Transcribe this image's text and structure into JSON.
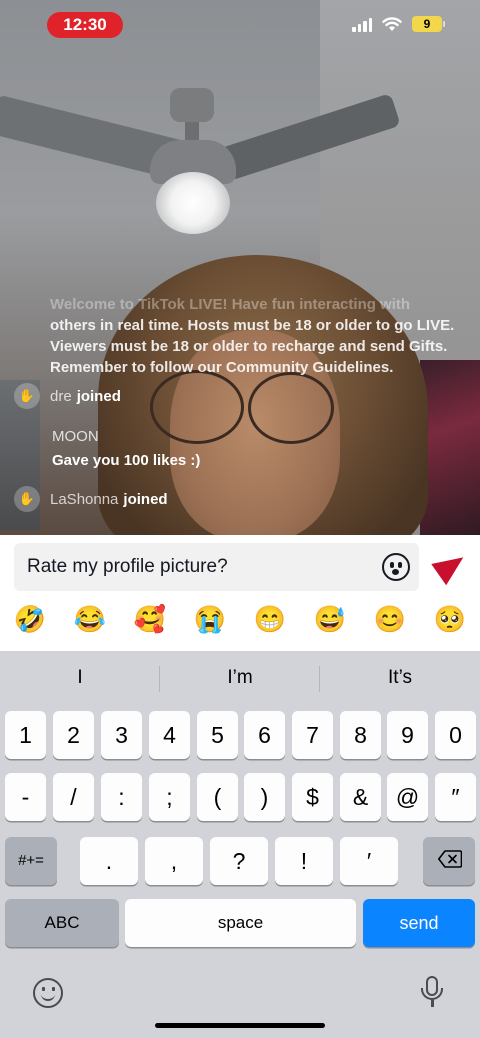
{
  "status_bar": {
    "time": "12:30",
    "battery": "9"
  },
  "chat": {
    "notice_top": "Welcome to TikTok LIVE! Have fun interacting with",
    "notice_main": "others in real time. Hosts must be 18 or older to go LIVE. Viewers must be 18 or older to recharge and send Gifts. Remember to follow our Community Guidelines.",
    "messages": [
      {
        "user": "dre",
        "action": "joined"
      },
      {
        "user": "MOON",
        "text": "Gave you 100 likes :)"
      },
      {
        "user": "LaShonna",
        "action": "joined"
      }
    ]
  },
  "comment_input": {
    "value": "Rate my profile picture?"
  },
  "emoji_bar": [
    "🤣",
    "😂",
    "🥰",
    "😭",
    "😁",
    "😅",
    "😊",
    "🥺"
  ],
  "keyboard": {
    "suggestions": [
      "I",
      "I’m",
      "It’s"
    ],
    "row1": [
      "1",
      "2",
      "3",
      "4",
      "5",
      "6",
      "7",
      "8",
      "9",
      "0"
    ],
    "row2": [
      "-",
      "/",
      ":",
      ";",
      "(",
      ")",
      "$",
      "&",
      "@",
      "″"
    ],
    "row3_mode": "#+=",
    "row3": [
      ".",
      ",",
      "?",
      "!",
      "′"
    ],
    "abc": "ABC",
    "space": "space",
    "send": "send"
  },
  "colors": {
    "accent": "#c8102e",
    "send_key": "#0a84ff",
    "time_pill": "#e0232b"
  }
}
